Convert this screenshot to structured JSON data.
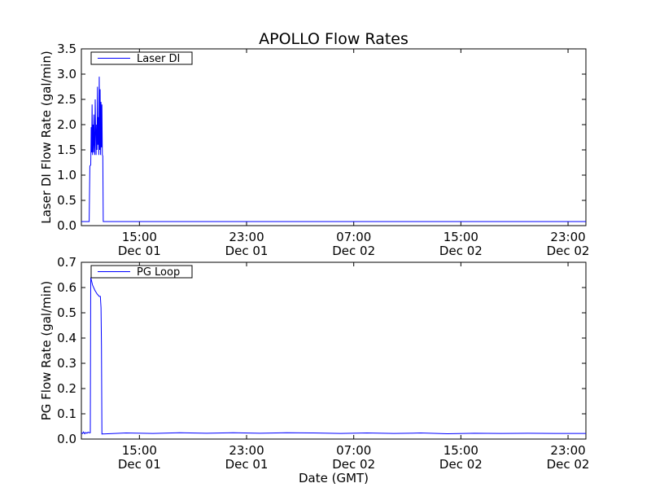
{
  "figure_title": "APOLLO Flow Rates",
  "colors": {
    "series": "#0000ff",
    "axis": "#000000",
    "background": "#ffffff"
  },
  "chart_data": [
    {
      "type": "line",
      "ylabel": "Laser DI Flow Rate (gal/min)",
      "xlabel": "",
      "ylim": [
        0,
        3.5
      ],
      "yticks": [
        "0.0",
        "0.5",
        "1.0",
        "1.5",
        "2.0",
        "2.5",
        "3.0",
        "3.5"
      ],
      "xlim": [
        "Dec 01 10:40",
        "Dec 03 00:20"
      ],
      "xticks": [
        {
          "time": "15:00",
          "date": "Dec 01",
          "t": "Dec 01 15:00"
        },
        {
          "time": "23:00",
          "date": "Dec 01",
          "t": "Dec 01 23:00"
        },
        {
          "time": "07:00",
          "date": "Dec 02",
          "t": "Dec 02 07:00"
        },
        {
          "time": "15:00",
          "date": "Dec 02",
          "t": "Dec 02 15:00"
        },
        {
          "time": "23:00",
          "date": "Dec 02",
          "t": "Dec 02 23:00"
        }
      ],
      "legend": "upper-left",
      "grid": false,
      "series": [
        {
          "name": "Laser DI",
          "points": [
            [
              "Dec 01 10:40",
              0.08
            ],
            [
              "Dec 01 11:15",
              0.08
            ],
            [
              "Dec 01 11:18",
              1.18
            ],
            [
              "Dec 01 11:22",
              1.2
            ],
            [
              "Dec 01 11:24",
              1.95
            ],
            [
              "Dec 01 11:26",
              1.45
            ],
            [
              "Dec 01 11:28",
              2.4
            ],
            [
              "Dec 01 11:30",
              1.4
            ],
            [
              "Dec 01 11:32",
              2.0
            ],
            [
              "Dec 01 11:34",
              1.45
            ],
            [
              "Dec 01 11:36",
              2.2
            ],
            [
              "Dec 01 11:38",
              1.6
            ],
            [
              "Dec 01 11:40",
              1.4
            ],
            [
              "Dec 01 11:42",
              2.5
            ],
            [
              "Dec 01 11:44",
              1.9
            ],
            [
              "Dec 01 11:46",
              1.4
            ],
            [
              "Dec 01 11:48",
              2.0
            ],
            [
              "Dec 01 11:50",
              1.5
            ],
            [
              "Dec 01 11:52",
              2.75
            ],
            [
              "Dec 01 11:54",
              1.6
            ],
            [
              "Dec 01 11:56",
              2.15
            ],
            [
              "Dec 01 11:58",
              1.4
            ],
            [
              "Dec 01 12:00",
              2.95
            ],
            [
              "Dec 01 12:02",
              1.5
            ],
            [
              "Dec 01 12:04",
              2.7
            ],
            [
              "Dec 01 12:06",
              1.4
            ],
            [
              "Dec 01 12:08",
              2.45
            ],
            [
              "Dec 01 12:10",
              1.55
            ],
            [
              "Dec 01 12:12",
              2.4
            ],
            [
              "Dec 01 12:14",
              1.4
            ],
            [
              "Dec 01 12:16",
              1.38
            ],
            [
              "Dec 01 12:18",
              0.08
            ],
            [
              "Dec 03 00:20",
              0.08
            ]
          ]
        }
      ]
    },
    {
      "type": "line",
      "ylabel": "PG Flow Rate (gal/min)",
      "xlabel": "Date (GMT)",
      "ylim": [
        0,
        0.7
      ],
      "yticks": [
        "0.0",
        "0.1",
        "0.2",
        "0.3",
        "0.4",
        "0.5",
        "0.6",
        "0.7"
      ],
      "xlim": [
        "Dec 01 10:40",
        "Dec 03 00:20"
      ],
      "xticks": [
        {
          "time": "15:00",
          "date": "Dec 01",
          "t": "Dec 01 15:00"
        },
        {
          "time": "23:00",
          "date": "Dec 01",
          "t": "Dec 01 23:00"
        },
        {
          "time": "07:00",
          "date": "Dec 02",
          "t": "Dec 02 07:00"
        },
        {
          "time": "15:00",
          "date": "Dec 02",
          "t": "Dec 02 15:00"
        },
        {
          "time": "23:00",
          "date": "Dec 02",
          "t": "Dec 02 23:00"
        }
      ],
      "legend": "upper-left",
      "grid": false,
      "series": [
        {
          "name": "PG Loop",
          "points": [
            [
              "Dec 01 10:40",
              0.025
            ],
            [
              "Dec 01 10:45",
              0.022
            ],
            [
              "Dec 01 10:50",
              0.028
            ],
            [
              "Dec 01 10:55",
              0.021
            ],
            [
              "Dec 01 11:00",
              0.026
            ],
            [
              "Dec 01 11:05",
              0.023
            ],
            [
              "Dec 01 11:10",
              0.027
            ],
            [
              "Dec 01 11:15",
              0.025
            ],
            [
              "Dec 01 11:20",
              0.025
            ],
            [
              "Dec 01 11:22",
              0.64
            ],
            [
              "Dec 01 11:30",
              0.61
            ],
            [
              "Dec 01 11:40",
              0.59
            ],
            [
              "Dec 01 11:50",
              0.575
            ],
            [
              "Dec 01 12:00",
              0.565
            ],
            [
              "Dec 01 12:05",
              0.565
            ],
            [
              "Dec 01 12:08",
              0.52
            ],
            [
              "Dec 01 12:10",
              0.37
            ],
            [
              "Dec 01 12:12",
              0.02
            ],
            [
              "Dec 01 14:00",
              0.024
            ],
            [
              "Dec 01 16:00",
              0.022
            ],
            [
              "Dec 01 18:00",
              0.025
            ],
            [
              "Dec 01 20:00",
              0.023
            ],
            [
              "Dec 01 22:00",
              0.025
            ],
            [
              "Dec 02 00:00",
              0.023
            ],
            [
              "Dec 02 02:00",
              0.025
            ],
            [
              "Dec 02 04:00",
              0.024
            ],
            [
              "Dec 02 06:00",
              0.022
            ],
            [
              "Dec 02 08:00",
              0.024
            ],
            [
              "Dec 02 10:00",
              0.022
            ],
            [
              "Dec 02 12:00",
              0.024
            ],
            [
              "Dec 02 14:00",
              0.021
            ],
            [
              "Dec 02 16:00",
              0.023
            ],
            [
              "Dec 02 18:00",
              0.022
            ],
            [
              "Dec 02 20:00",
              0.023
            ],
            [
              "Dec 02 22:00",
              0.022
            ],
            [
              "Dec 03 00:20",
              0.022
            ]
          ]
        }
      ]
    }
  ]
}
